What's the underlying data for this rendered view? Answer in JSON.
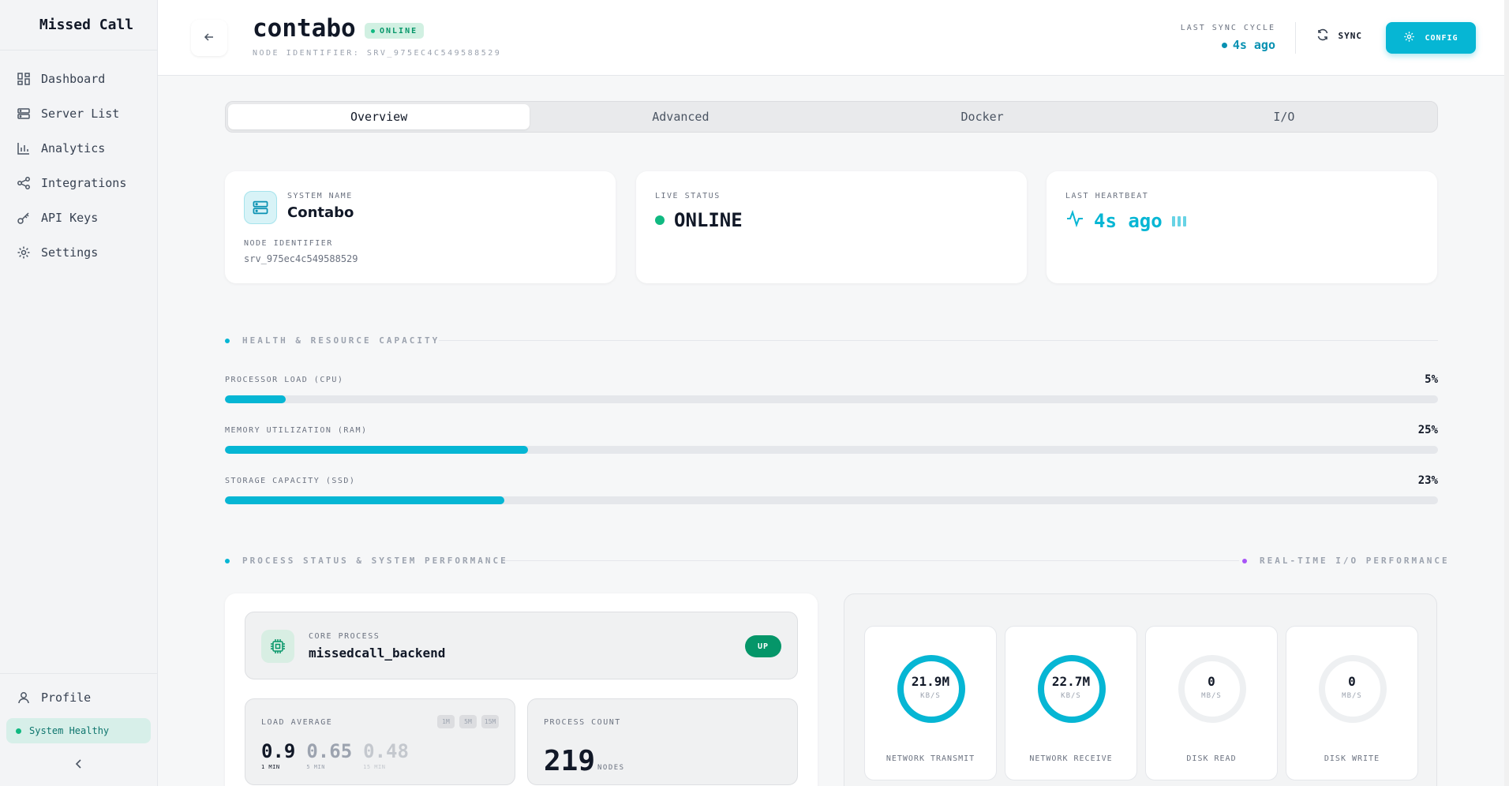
{
  "brand": "Missed Call",
  "sidebar": {
    "items": [
      {
        "label": "Dashboard",
        "icon": "dashboard-icon"
      },
      {
        "label": "Server List",
        "icon": "server-list-icon"
      },
      {
        "label": "Analytics",
        "icon": "analytics-icon"
      },
      {
        "label": "Integrations",
        "icon": "integrations-icon"
      },
      {
        "label": "API Keys",
        "icon": "key-icon"
      },
      {
        "label": "Settings",
        "icon": "gear-icon"
      }
    ],
    "profile": "Profile",
    "health": "System Healthy"
  },
  "header": {
    "title": "contabo",
    "status": "ONLINE",
    "node_identifier": "NODE IDENTIFIER: SRV_975EC4C549588529",
    "sync_label": "LAST SYNC CYCLE",
    "sync_time": "4s ago",
    "sync_button": "SYNC",
    "config_button": "CONFIG"
  },
  "tabs": [
    "Overview",
    "Advanced",
    "Docker",
    "I/O"
  ],
  "cards": {
    "system_name_label": "SYSTEM NAME",
    "system_name": "Contabo",
    "node_id_label": "NODE IDENTIFIER",
    "node_id": "srv_975ec4c549588529",
    "live_status_label": "LIVE STATUS",
    "live_status": "ONLINE",
    "heartbeat_label": "LAST HEARTBEAT",
    "heartbeat": "4s ago"
  },
  "health_section": {
    "title": "HEALTH & RESOURCE CAPACITY",
    "resources": [
      {
        "label": "PROCESSOR LOAD (CPU)",
        "value": "5%",
        "percent": 5
      },
      {
        "label": "MEMORY UTILIZATION (RAM)",
        "value": "25%",
        "percent": 25
      },
      {
        "label": "STORAGE CAPACITY (SSD)",
        "value": "23%",
        "percent": 23
      }
    ]
  },
  "process_section": {
    "title": "PROCESS STATUS & SYSTEM PERFORMANCE",
    "io_title": "REAL-TIME I/O PERFORMANCE",
    "core_label": "CORE PROCESS",
    "core_name": "missedcall_backend",
    "core_status": "UP",
    "load_label": "LOAD AVERAGE",
    "load_chips": [
      "1M",
      "5M",
      "15M"
    ],
    "load_values": [
      {
        "value": "0.9",
        "label": "1 MIN"
      },
      {
        "value": "0.65",
        "label": "5 MIN"
      },
      {
        "value": "0.48",
        "label": "15 MIN"
      }
    ],
    "process_count_label": "PROCESS COUNT",
    "process_count": "219",
    "process_count_unit": "NODES"
  },
  "io": [
    {
      "value": "21.9M",
      "unit": "KB/S",
      "name": "NETWORK TRANSMIT",
      "active": true
    },
    {
      "value": "22.7M",
      "unit": "KB/S",
      "name": "NETWORK RECEIVE",
      "active": true
    },
    {
      "value": "0",
      "unit": "MB/S",
      "name": "DISK READ",
      "active": false
    },
    {
      "value": "0",
      "unit": "MB/S",
      "name": "DISK WRITE",
      "active": false
    }
  ],
  "colors": {
    "accent": "#06b6d4",
    "success": "#10b981",
    "io_dot": "#a855f7"
  }
}
